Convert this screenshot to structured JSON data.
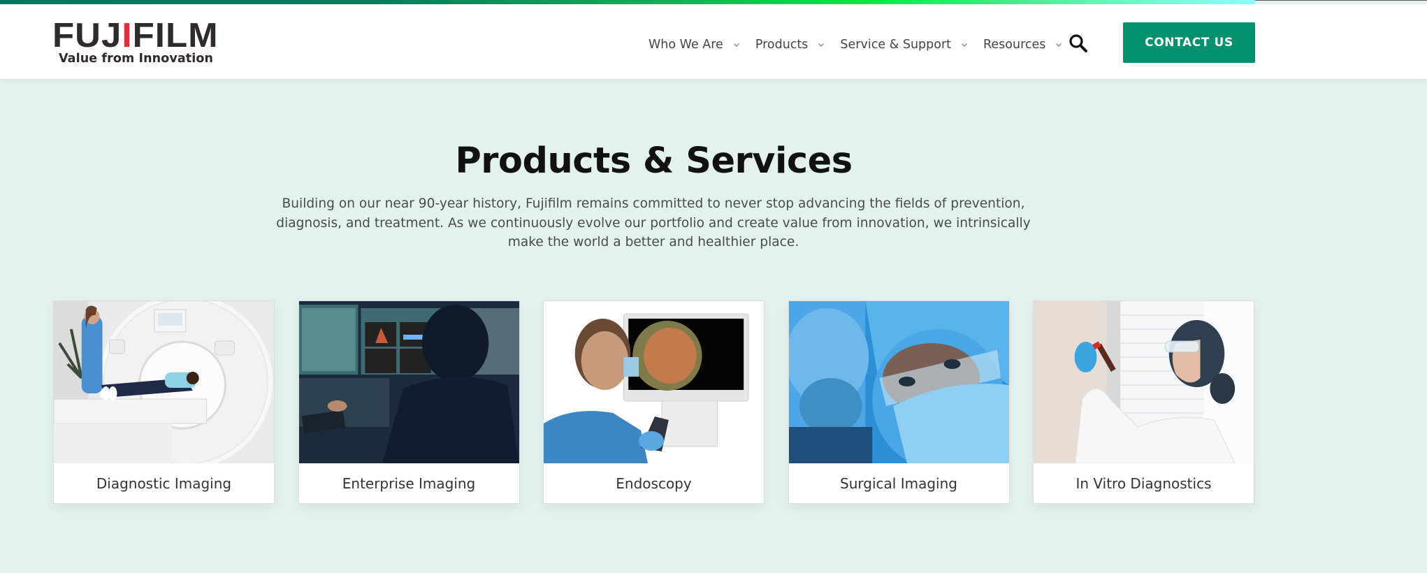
{
  "brand": {
    "name_part1": "FUJ",
    "name_accent": "I",
    "name_part2": "FILM",
    "tagline": "Value from Innovation"
  },
  "colors": {
    "brand_green": "#02916d",
    "background": "#e3f2ef",
    "logo_red": "#e42d3b"
  },
  "nav": {
    "items": [
      {
        "label": "Who We Are",
        "icon": "chevron-down-icon"
      },
      {
        "label": "Products",
        "icon": "chevron-down-icon"
      },
      {
        "label": "Service & Support",
        "icon": "chevron-down-icon"
      },
      {
        "label": "Resources",
        "icon": "chevron-down-icon"
      }
    ],
    "search_icon": "search-icon",
    "contact_label": "CONTACT US"
  },
  "main": {
    "title": "Products & Services",
    "intro": "Building on our near 90-year history, Fujifilm remains committed to never stop advancing the fields of prevention, diagnosis, and treatment. As we continuously evolve our portfolio and create value from innovation, we intrinsically make the world a better and healthier place.",
    "cards": [
      {
        "label": "Diagnostic Imaging",
        "image": "ct-scanner-photo"
      },
      {
        "label": "Enterprise Imaging",
        "image": "radiologist-workstation-photo"
      },
      {
        "label": "Endoscopy",
        "image": "endoscopy-monitor-photo"
      },
      {
        "label": "Surgical Imaging",
        "image": "surgeons-photo"
      },
      {
        "label": "In Vitro Diagnostics",
        "image": "lab-scientist-photo"
      }
    ]
  }
}
